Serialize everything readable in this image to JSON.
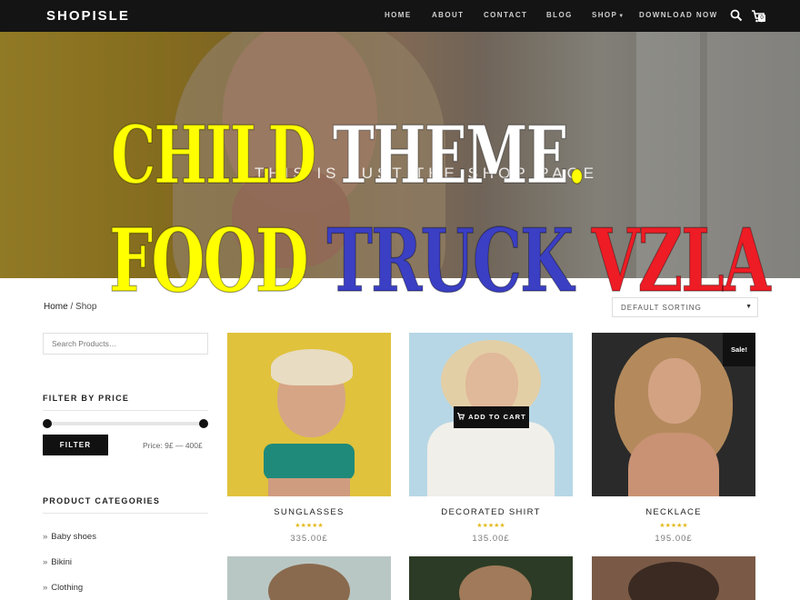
{
  "header": {
    "logo": "SHOPISLE",
    "nav": [
      {
        "label": "HOME"
      },
      {
        "label": "ABOUT"
      },
      {
        "label": "CONTACT"
      },
      {
        "label": "BLOG"
      },
      {
        "label": "SHOP"
      },
      {
        "label": "DOWNLOAD NOW"
      }
    ],
    "cart_count": "0",
    "icons": {
      "search": "search-icon",
      "cart": "cart-icon"
    }
  },
  "hero": {
    "subtitle": "THIS IS JUST THE SHOP PAGE",
    "overlay_line1": [
      {
        "text": "CHILD",
        "color": "#ffff00"
      },
      {
        "text": "THEME",
        "color": "#ffffff"
      },
      {
        "text": ".",
        "color": "#ffff00"
      }
    ],
    "overlay_line2": [
      {
        "text": "FOOD",
        "color": "#ffff00"
      },
      {
        "text": "TRUCK",
        "color": "#3b3fc4"
      },
      {
        "text": "VZLA",
        "color": "#ee1c25"
      }
    ]
  },
  "breadcrumb": {
    "home": "Home",
    "separator": " / ",
    "current": "Shop"
  },
  "sorting": {
    "selected": "Default sorting"
  },
  "sidebar": {
    "search_placeholder": "Search Products…",
    "filter_title": "FILTER BY PRICE",
    "filter_button": "FILTER",
    "price_label": "Price:",
    "price_min": "9£",
    "price_max": "400£",
    "price_dash": "—",
    "categories_title": "PRODUCT CATEGORIES",
    "categories": [
      {
        "label": "Baby shoes"
      },
      {
        "label": "Bikini"
      },
      {
        "label": "Clothing"
      }
    ]
  },
  "products": [
    {
      "name": "SUNGLASSES",
      "price": "335.00£",
      "rating_stars": 5,
      "badge": "",
      "hover_button": ""
    },
    {
      "name": "DECORATED SHIRT",
      "price": "135.00£",
      "rating_stars": 5,
      "badge": "",
      "hover_button": "ADD TO CART"
    },
    {
      "name": "NECKLACE",
      "price": "195.00£",
      "rating_stars": 5,
      "badge": "Sale!",
      "hover_button": ""
    }
  ],
  "colors": {
    "accent": "#111111",
    "star": "#e3b91d",
    "topbar": "#141414"
  }
}
